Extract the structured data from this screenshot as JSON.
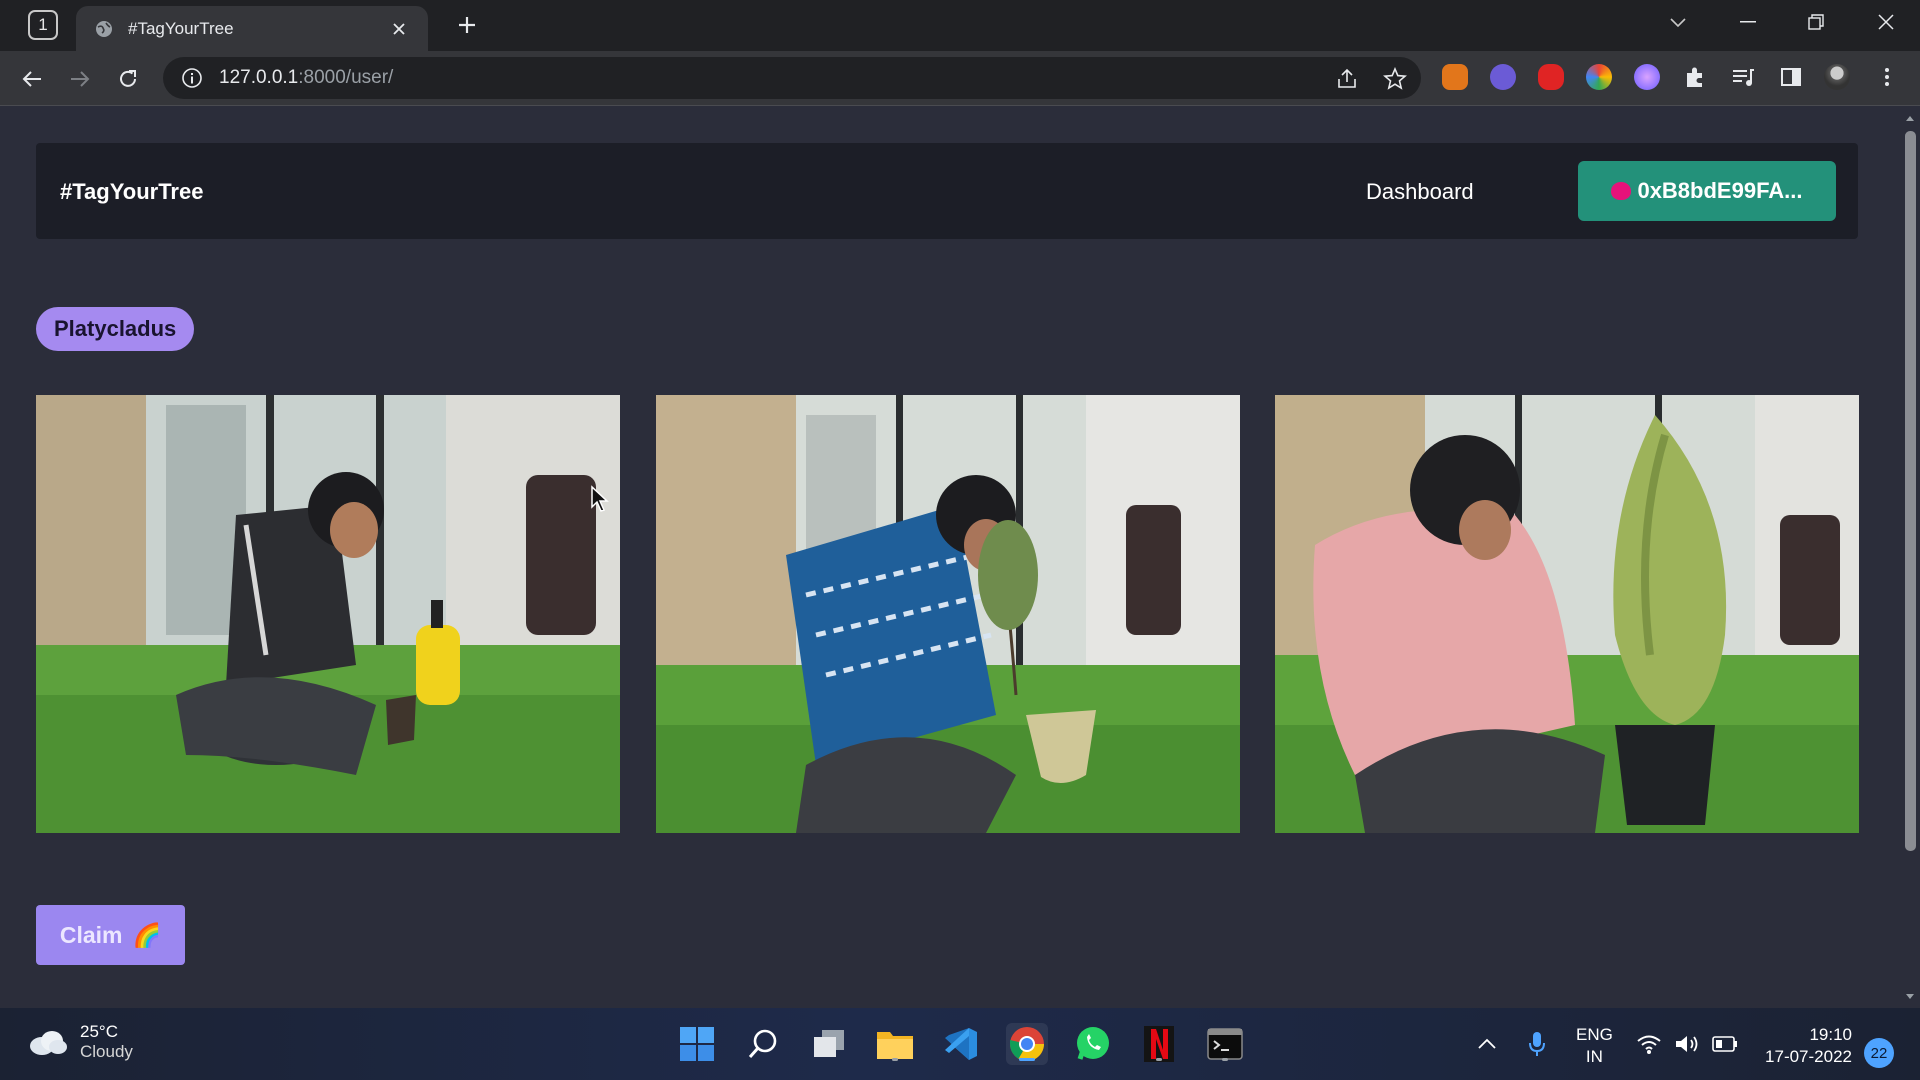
{
  "browser": {
    "tab_count": "1",
    "tab_title": "#TagYourTree",
    "url_host": "127.0.0.1",
    "url_path": ":8000/user/"
  },
  "site": {
    "brand": "#TagYourTree",
    "nav_dashboard": "Dashboard",
    "wallet_address": "0xB8bdE99FA...",
    "species": "Platycladus",
    "claim_label": "Claim",
    "claim_emoji": "🌈"
  },
  "photos": [
    {
      "alt": "person in grey tracksuit planting sapling near yellow bottle"
    },
    {
      "alt": "person in blue patterned shirt tending potted tree"
    },
    {
      "alt": "person in pink sweater beside potted Platycladus tree"
    }
  ],
  "taskbar": {
    "temperature": "25°C",
    "condition": "Cloudy",
    "lang_1": "ENG",
    "lang_2": "IN",
    "time": "19:10",
    "date": "17-07-2022",
    "notification_count": "22"
  },
  "colors": {
    "page_bg": "#2b2d3a",
    "navbar_bg": "#1c1e27",
    "wallet_button": "#23917a",
    "species_badge": "#a58af0",
    "claim_button": "#9b87f0"
  }
}
